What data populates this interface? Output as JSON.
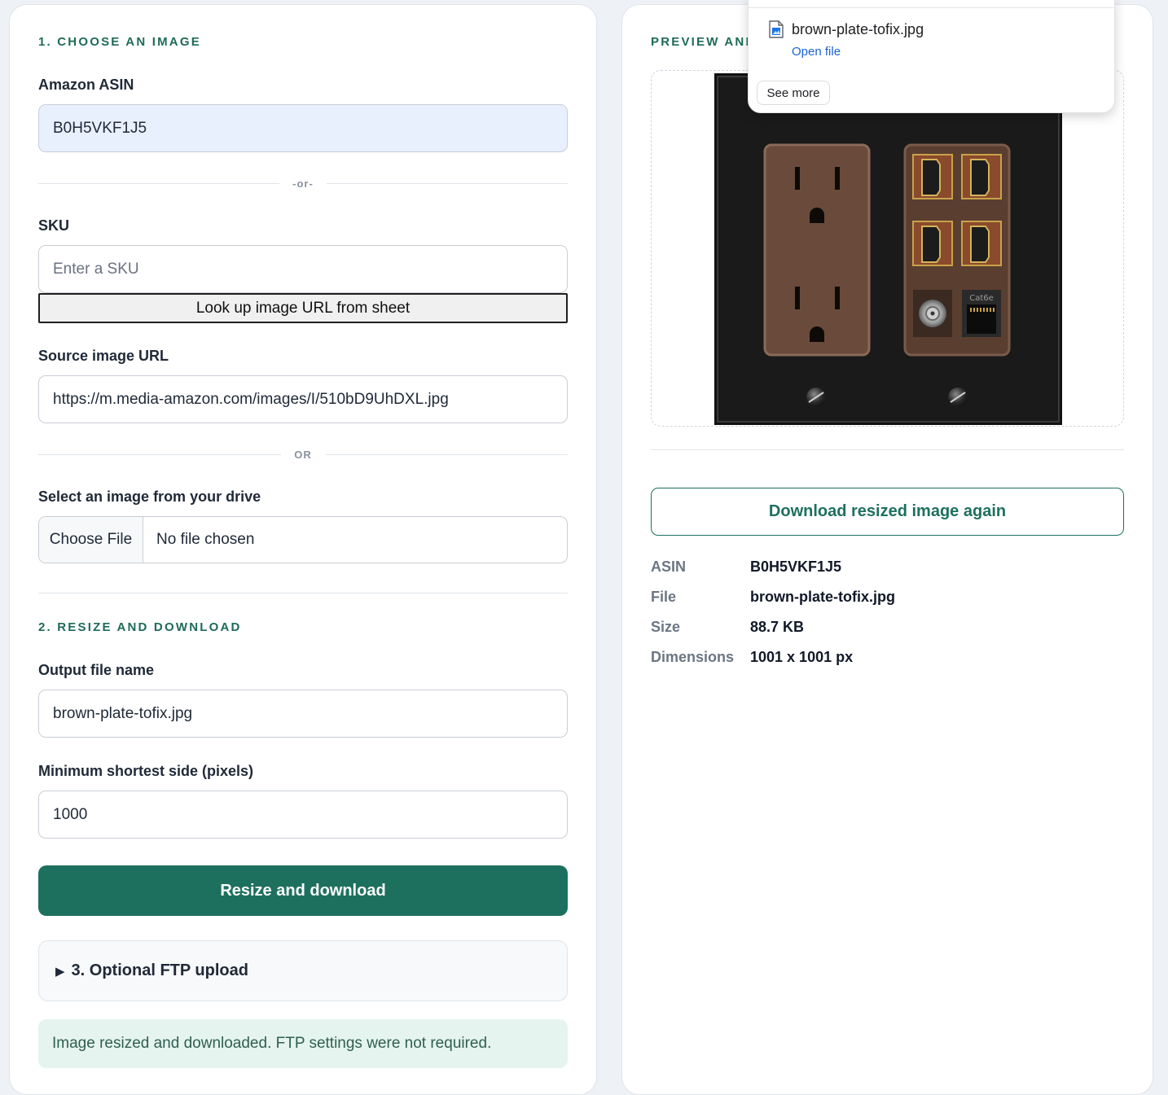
{
  "left": {
    "section1_heading": "1. CHOOSE AN IMAGE",
    "asin_label": "Amazon ASIN",
    "asin_value": "B0H5VKF1J5",
    "divider_or_small": "-or-",
    "sku_label": "SKU",
    "sku_placeholder": "Enter a SKU",
    "lookup_button": "Look up image URL from sheet",
    "source_url_label": "Source image URL",
    "source_url_value": "https://m.media-amazon.com/images/I/510bD9UhDXL.jpg",
    "divider_or": "OR",
    "drive_label": "Select an image from your drive",
    "file_choose_button": "Choose File",
    "file_status": "No file chosen",
    "section2_heading": "2. RESIZE AND DOWNLOAD",
    "output_label": "Output file name",
    "output_value": "brown-plate-tofix.jpg",
    "min_side_label": "Minimum shortest side (pixels)",
    "min_side_value": "1000",
    "resize_button": "Resize and download",
    "ftp_summary": "3. Optional FTP upload",
    "status_message": "Image resized and downloaded. FTP settings were not required."
  },
  "right": {
    "section_heading": "PREVIEW AND",
    "download_again_button": "Download resized image again",
    "meta": [
      {
        "key": "ASIN",
        "value": "B0H5VKF1J5"
      },
      {
        "key": "File",
        "value": "brown-plate-tofix.jpg"
      },
      {
        "key": "Size",
        "value": "88.7 KB"
      },
      {
        "key": "Dimensions",
        "value": "1001 x 1001 px"
      }
    ],
    "preview_outlet_label": "Cat6e"
  },
  "downloads_popup": {
    "file_name": "brown-plate-tofix.jpg",
    "open_link": "Open file",
    "see_more": "See more"
  },
  "colors": {
    "accent": "#1e705e",
    "heading": "#1e6b57",
    "background": "#eef1f6",
    "status_bg": "#e5f4ee",
    "link": "#1a62d6"
  },
  "icons": {
    "ftp_toggle": "triangle-right-icon",
    "download_file": "image-file-icon"
  }
}
